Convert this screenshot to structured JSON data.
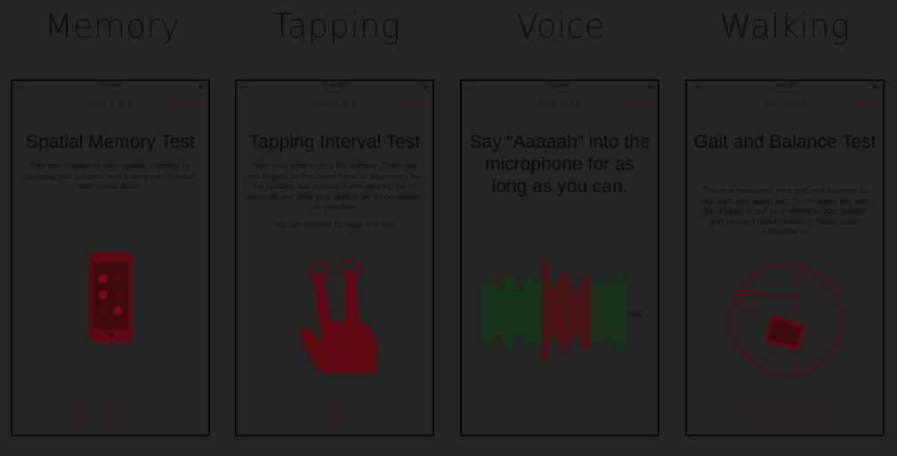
{
  "titles": {
    "memory": "Memory",
    "tapping": "Tapping",
    "voice": "Voice",
    "walking": "Walking"
  },
  "status": {
    "memory_time": "6:34 PM",
    "tapping_time": "6:35 PM",
    "voice_time": "6:35 PM",
    "walking_time": "6:36 PM"
  },
  "memory": {
    "step": "Step 1 of 4",
    "cancel": "Cancel",
    "heading": "Spatial Memory Test",
    "description": "This test measures your spatial memory by showing you patterns and asking you to recall and repeat them.",
    "button": "Next",
    "icon": "phone-flowers-icon"
  },
  "tapping": {
    "step": "Step 5 of 5",
    "cancel": "Cancel",
    "back": "<",
    "heading": "Tapping Interval Test",
    "description": "Rest your phone on a flat surface. Then use two fingers on the same hand to alternately tap the buttons that appear. Keep tapping for 20 seconds and time your taps to be as consistent as possible.",
    "description2": "Tap Get Started to begin the test.",
    "button": "Next",
    "icon": "two-finger-hand-icon"
  },
  "voice": {
    "step": "Step 5 of 6",
    "cancel": "Cancel",
    "heading": "Say “Aaaaah” into the microphone for as long as you can.",
    "waveform_label": "ndo",
    "icon": "audio-waveform-icon"
  },
  "walking": {
    "step": "Step 1 of 6",
    "cancel": "Cancel",
    "heading": "Gait and Balance Test",
    "description": "This test measures your gait and balance as you walk and stand still. To complete the test, you'll need to put your phone in your pocket and connect headphones to follow audio instructions.",
    "button": "Get Started",
    "icon": "pocket-phone-icon"
  },
  "colors": {
    "accent": "#3e1c1e",
    "illustration": "#6a0a12",
    "wave_green": "#0f3a14",
    "wave_red": "#5a0c10"
  }
}
